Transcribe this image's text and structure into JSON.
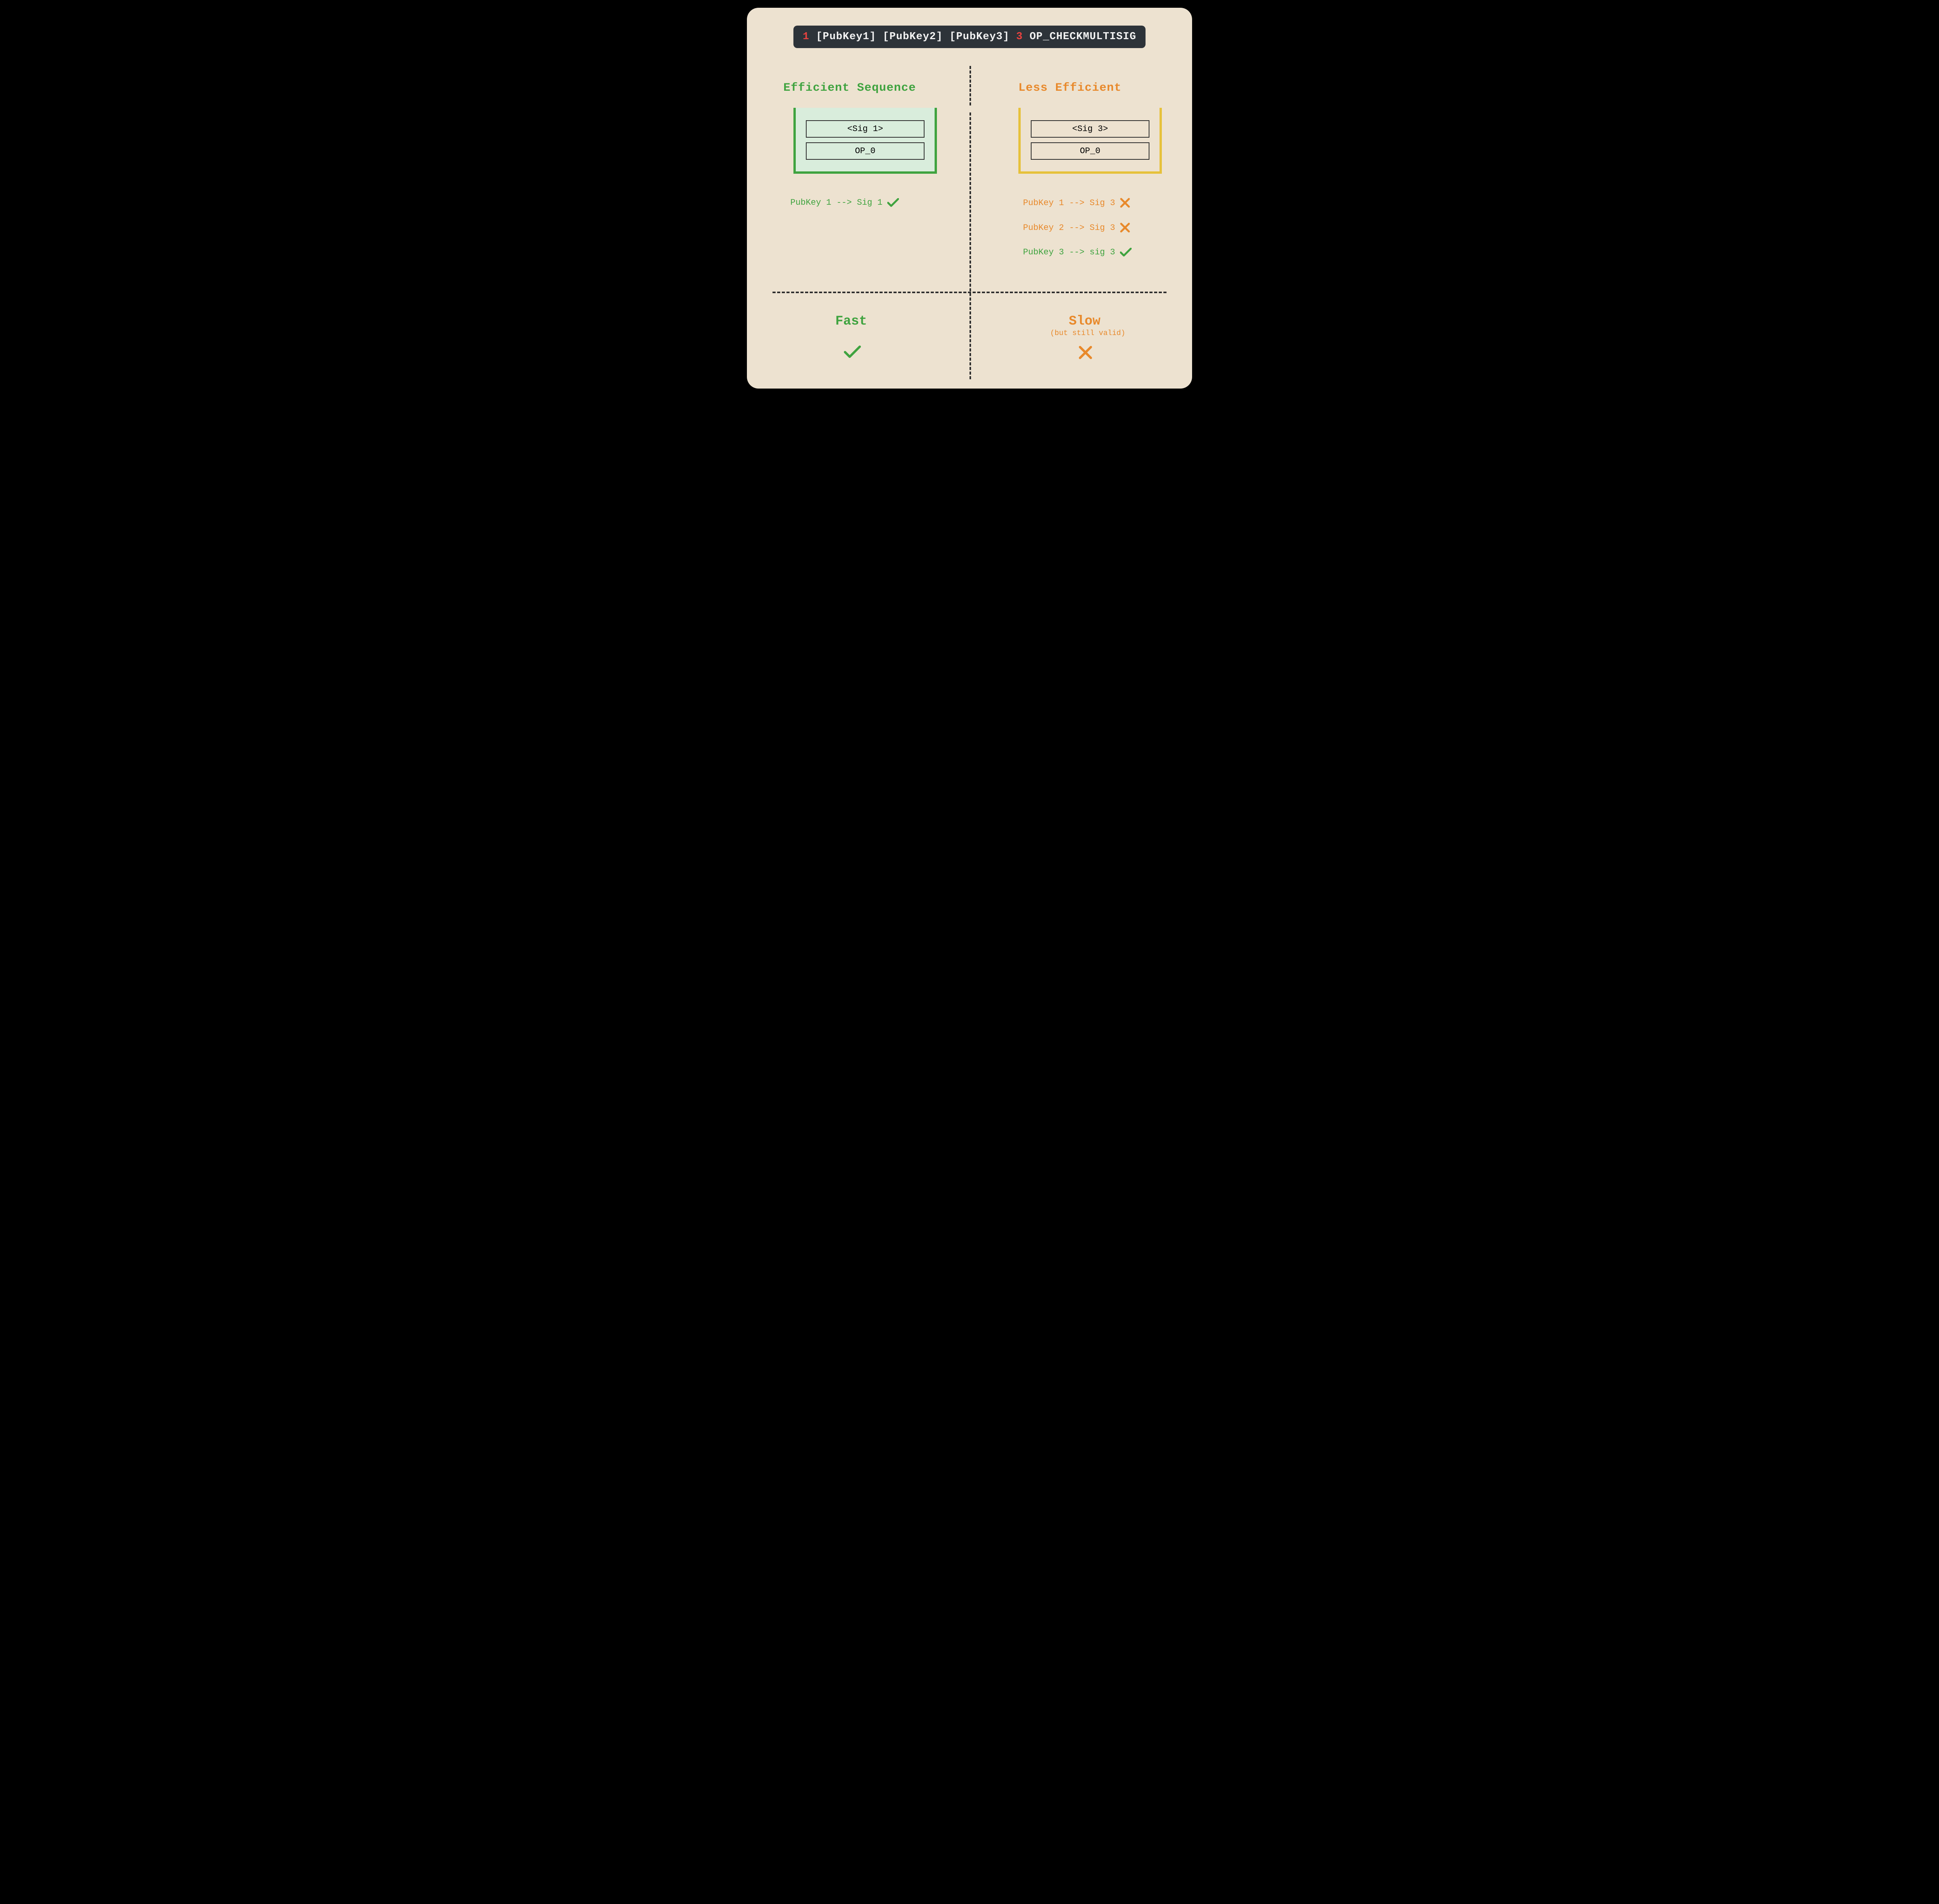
{
  "script": {
    "n1": "1",
    "pk1": "[PubKey1]",
    "pk2": "[PubKey2]",
    "pk3": "[PubKey3]",
    "n2": "3",
    "op": "OP_CHECKMULTISIG"
  },
  "left": {
    "title": "Efficient Sequence",
    "stack_top": "<Sig 1>",
    "stack_bot": "OP_0",
    "check1": "PubKey 1 --> Sig 1",
    "result": "Fast"
  },
  "right": {
    "title": "Less Efficient",
    "stack_top": "<Sig 3>",
    "stack_bot": "OP_0",
    "check1": "PubKey 1 --> Sig 3",
    "check2": "PubKey 2 --> Sig 3",
    "check3": "PubKey 3 --> sig 3",
    "result": "Slow",
    "subnote": "(but still valid)"
  },
  "colors": {
    "green": "#3fa33f",
    "orange": "#e8892b",
    "red": "#e9423f",
    "gold": "#e6c13a",
    "dark": "#2d3339",
    "bg": "#ede2d0"
  }
}
